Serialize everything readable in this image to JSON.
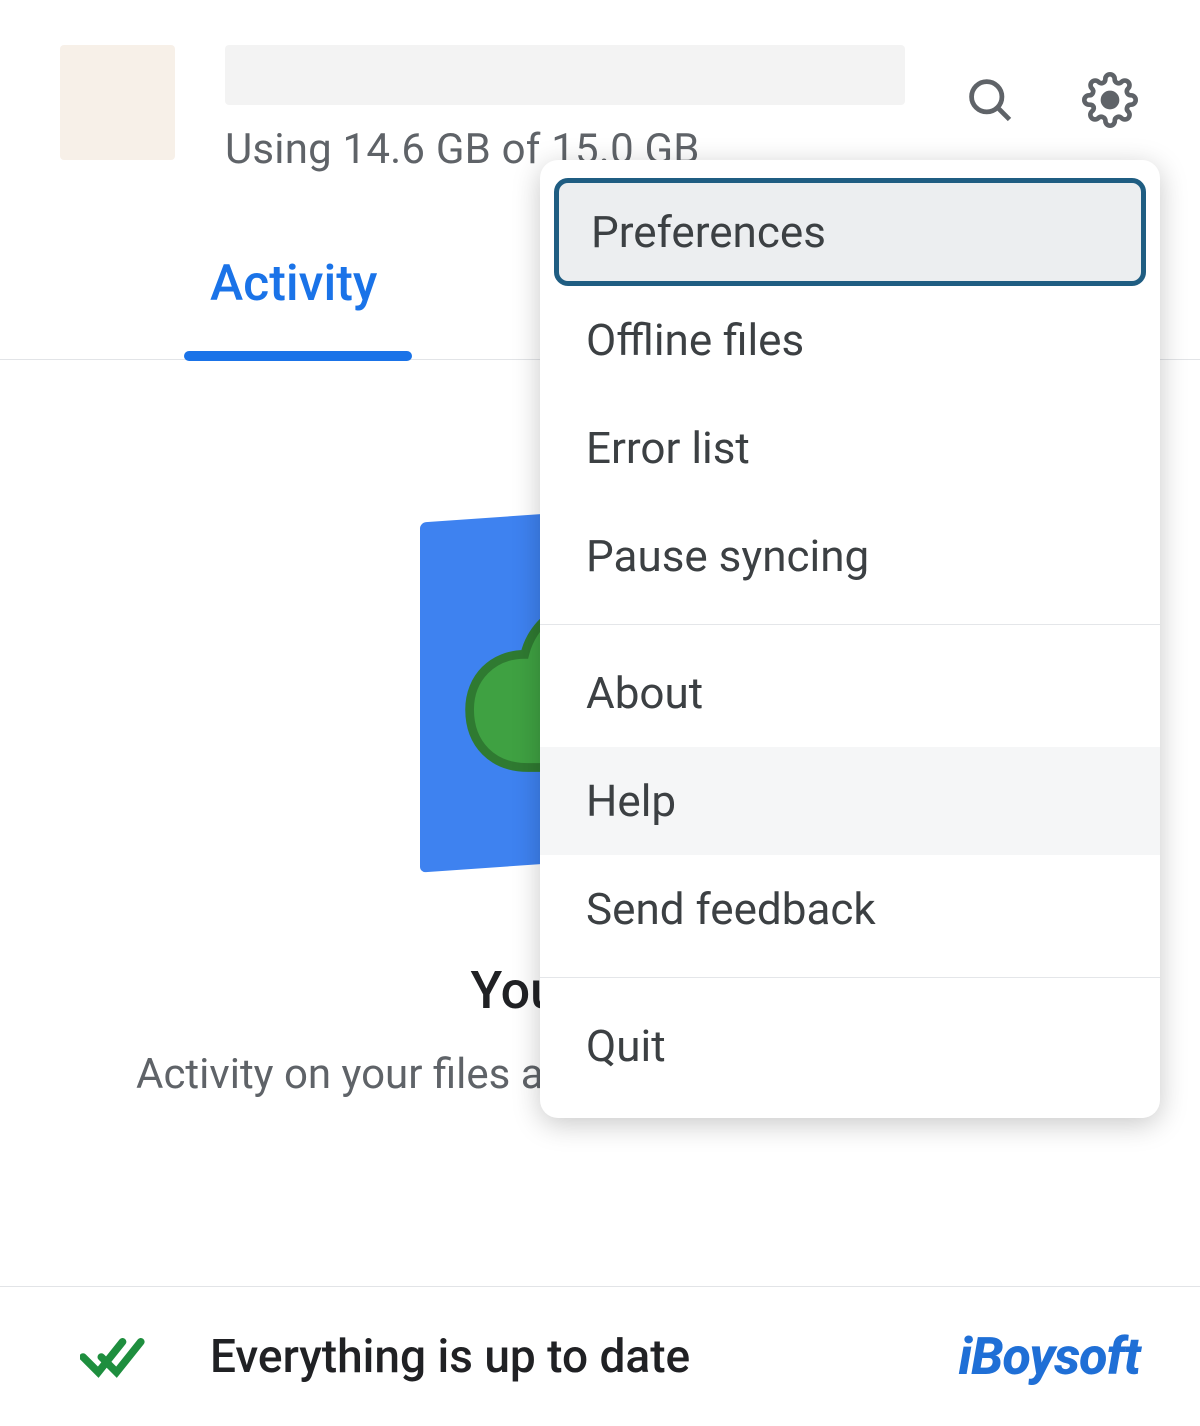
{
  "header": {
    "storage_text": "Using 14.6 GB of 15.0 GB"
  },
  "tabs": {
    "activity": "Activity"
  },
  "main": {
    "headline_partial": "Your files a",
    "subline": "Activity on your files and folders will show up here"
  },
  "footer": {
    "status": "Everything is up to date",
    "brand": "iBoysoft"
  },
  "menu": {
    "preferences": "Preferences",
    "offline_files": "Offline files",
    "error_list": "Error list",
    "pause_syncing": "Pause syncing",
    "about": "About",
    "help": "Help",
    "send_feedback": "Send feedback",
    "quit": "Quit"
  }
}
